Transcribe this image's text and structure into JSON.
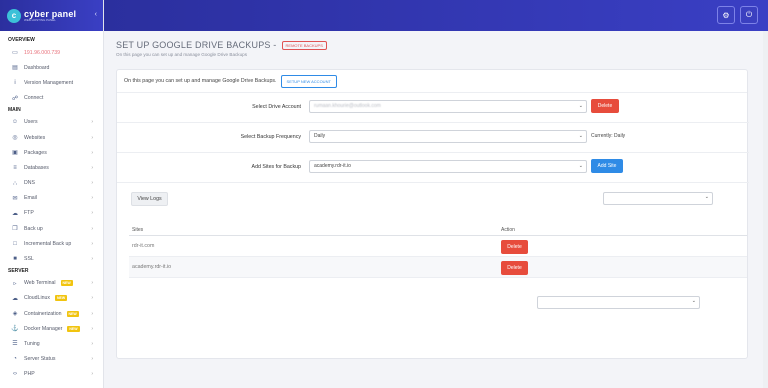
{
  "brand": {
    "name": "cyber panel",
    "tagline": "WEB HOSTING PANEL",
    "collapse_icon": "chevron-left-icon"
  },
  "sidebar": {
    "sections": [
      {
        "title": "OVERVIEW",
        "items": [
          {
            "label": "191.96.000.739",
            "icon": "monitor-icon",
            "chev": false,
            "ip": true
          },
          {
            "label": "Dashboard",
            "icon": "dashboard-icon",
            "chev": false
          },
          {
            "label": "Version Management",
            "icon": "info-icon",
            "chev": false
          },
          {
            "label": "Connect",
            "icon": "link-icon",
            "chev": false
          }
        ]
      },
      {
        "title": "MAIN",
        "items": [
          {
            "label": "Users",
            "icon": "users-icon",
            "chev": true
          },
          {
            "label": "Websites",
            "icon": "globe-icon",
            "chev": true
          },
          {
            "label": "Packages",
            "icon": "package-icon",
            "chev": true
          },
          {
            "label": "Databases",
            "icon": "database-icon",
            "chev": true
          },
          {
            "label": "DNS",
            "icon": "network-icon",
            "chev": true
          },
          {
            "label": "Email",
            "icon": "envelope-icon",
            "chev": true
          },
          {
            "label": "FTP",
            "icon": "cloud-upload-icon",
            "chev": true
          },
          {
            "label": "Back up",
            "icon": "copy-icon",
            "chev": true
          },
          {
            "label": "Incremental Back up",
            "icon": "file-icon",
            "chev": true
          },
          {
            "label": "SSL",
            "icon": "lock-icon",
            "chev": true
          }
        ]
      },
      {
        "title": "SERVER",
        "items": [
          {
            "label": "Web Terminal",
            "icon": "terminal-icon",
            "chev": true,
            "badge": "NEW"
          },
          {
            "label": "CloudLinux",
            "icon": "cloud-icon",
            "chev": true,
            "badge": "NEW"
          },
          {
            "label": "Containerization",
            "icon": "cube-icon",
            "chev": true,
            "badge": "NEW"
          },
          {
            "label": "Docker Manager",
            "icon": "docker-icon",
            "chev": true,
            "badge": "NEW"
          },
          {
            "label": "Tuning",
            "icon": "sliders-icon",
            "chev": true
          },
          {
            "label": "Server Status",
            "icon": "gauge-icon",
            "chev": true
          },
          {
            "label": "PHP",
            "icon": "code-icon",
            "chev": true
          }
        ]
      }
    ]
  },
  "topbar": {
    "settings_icon": "gear-icon",
    "power_icon": "power-icon"
  },
  "page": {
    "title": "SET UP GOOGLE DRIVE BACKUPS -",
    "badge": "REMOTE BACKUPS",
    "subtitle": "On this page you can set up and manage Google Drive Backups"
  },
  "card": {
    "intro": "On this page you can set up and manage Google Drive Backups.",
    "setup_button": "SETUP NEW ACCOUNT",
    "drive_account": {
      "label": "Select Drive Account",
      "value": "rumaan.khourie@outlook.com",
      "delete": "Delete"
    },
    "frequency": {
      "label": "Select Backup Frequency",
      "value": "Daily",
      "current": "Currently: Daily"
    },
    "sites": {
      "label": "Add Sites for Backup",
      "value": "academy.rdr-it.io",
      "add": "Add Site"
    },
    "view_logs": "View Logs",
    "table": {
      "headers": [
        "Sites",
        "Action"
      ],
      "rows": [
        {
          "site": "rdr-it.com",
          "action": "Delete"
        },
        {
          "site": "academy.rdr-it.io",
          "action": "Delete"
        }
      ]
    }
  }
}
